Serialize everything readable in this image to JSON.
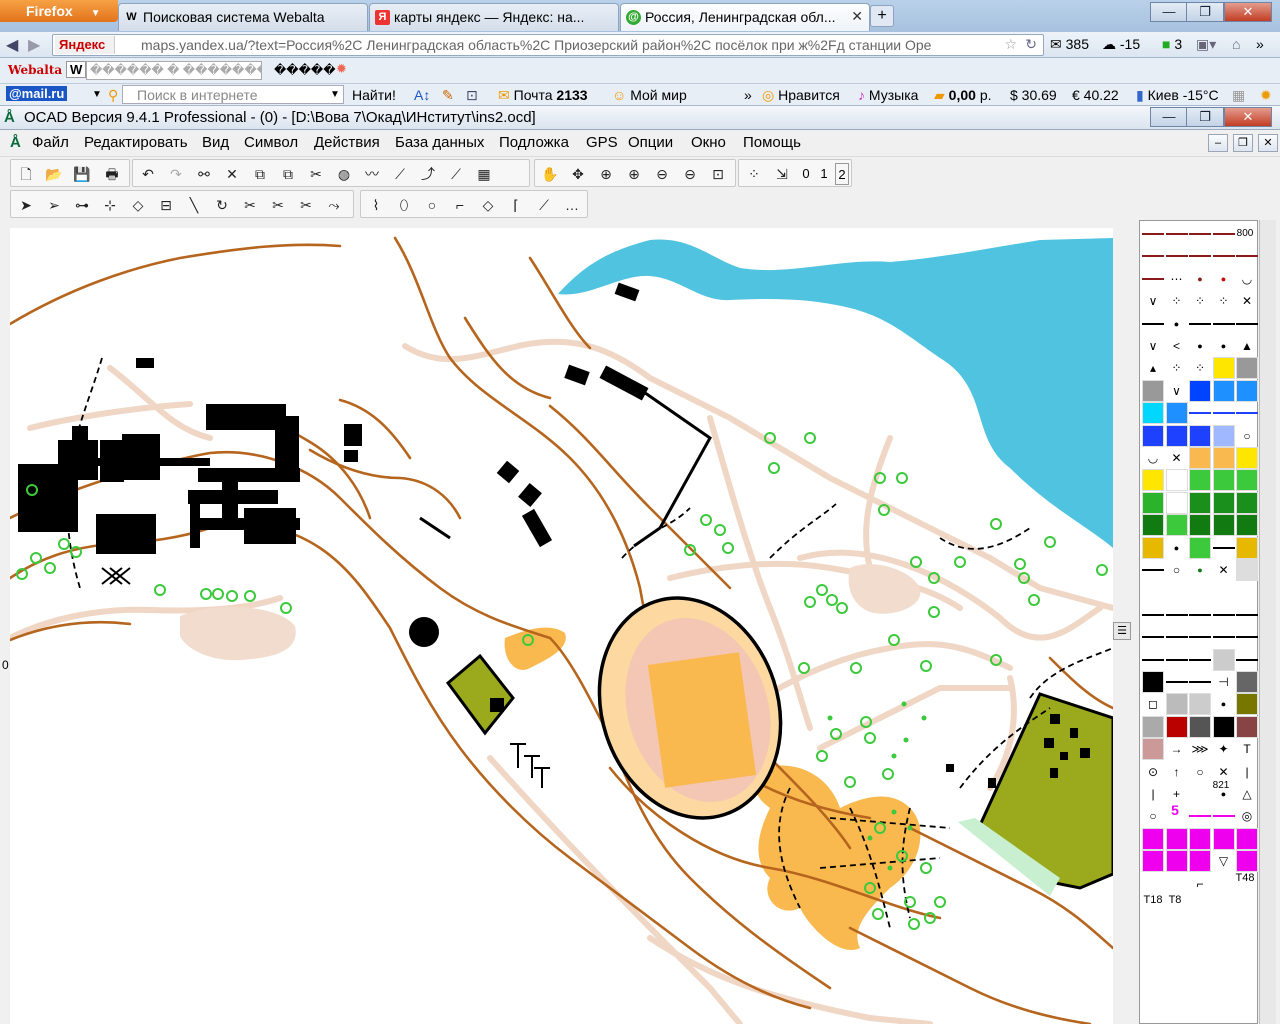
{
  "firefox": {
    "menu_button": "Firefox",
    "tabs": [
      {
        "label": "Поисковая система Webalta",
        "icon": "W"
      },
      {
        "label": "карты яндекс — Яндекс: на...",
        "icon": "Я"
      },
      {
        "label": "Россия, Ленинградская обл...",
        "icon": "@"
      }
    ],
    "new_tab": "+",
    "window_controls": {
      "minimize": "—",
      "maximize": "❐",
      "close": "✕"
    },
    "url_site": "Яндекс",
    "url": "maps.yandex.ua/?text=Россия%2C Ленинградская область%2C Приозерский район%2C посёлок при ж%2Fд станции Оре",
    "status_items": [
      {
        "label": "385",
        "icon": "mail-icon"
      },
      {
        "label": "-15",
        "icon": "weather-icon"
      },
      {
        "label": "3",
        "icon": "counter-icon"
      }
    ],
    "bookmarks1": {
      "webalta": "Webalta",
      "w_box": "W",
      "w_field": "������ � ��������",
      "extra": "�����"
    },
    "bookmarks2": {
      "mailru": "@mail.ru",
      "search_placeholder": "Поиск в интернете",
      "search_button": "Найти!",
      "mail_label": "Почта",
      "mail_count": "2133",
      "my_world": "Мой мир",
      "likes": "Нравится",
      "music": "Музыка",
      "balance": "0,00",
      "balance_unit": "р.",
      "usd": "$ 30.69",
      "eur": "€ 40.22",
      "city_weather": "Киев -15°C"
    }
  },
  "ocad": {
    "title": "OCAD Версия 9.4.1  Professional -  (0) - [D:\\Вова 7\\Окад\\ИНститут\\ins2.ocd]",
    "menu": [
      "Файл",
      "Редактировать",
      "Вид",
      "Символ",
      "Действия",
      "База данных",
      "Подложка",
      "GPS",
      "Опции",
      "Окно",
      "Помощь"
    ],
    "toolbar_numbers": [
      "0",
      "1",
      "2"
    ],
    "ruler_zero": "0",
    "symbol_numbers": {
      "s800": "800",
      "s821": "821",
      "s5": "5",
      "t18": "T18",
      "t8": "T8",
      "t48": "T48"
    }
  },
  "colors": {
    "contour": "#b5651d",
    "water": "#4fc3e0",
    "building": "#000000",
    "path": "#f0d6c4",
    "open_land": "#f9b94f",
    "olive": "#9aaa1c",
    "green_circle": "#3cc93c"
  }
}
